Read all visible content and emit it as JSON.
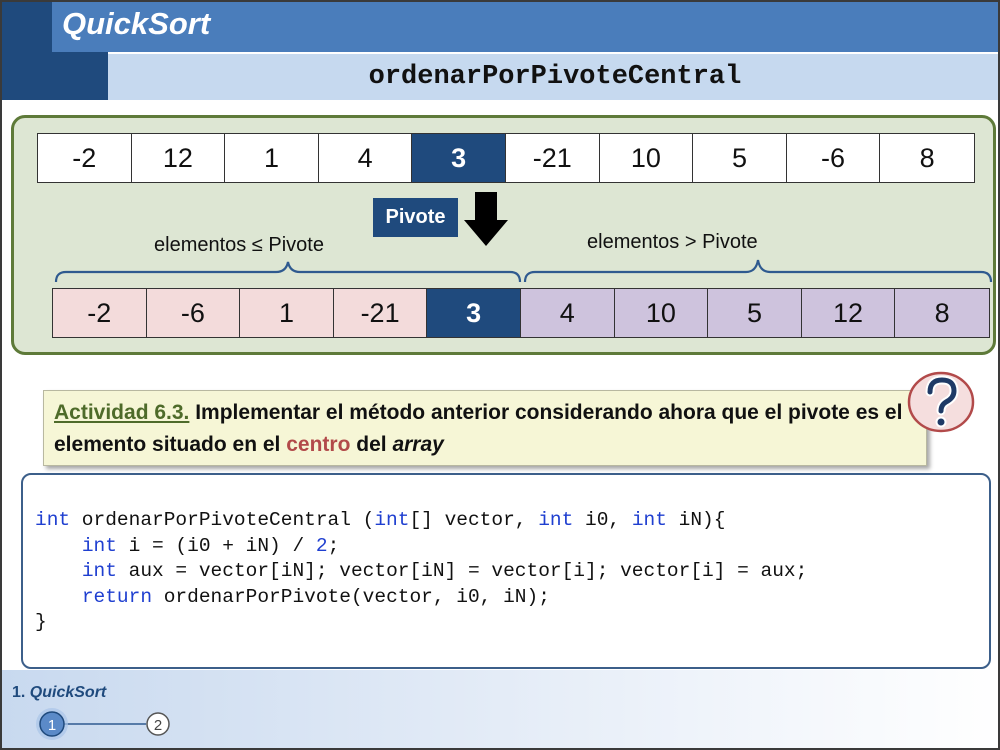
{
  "header": {
    "title": "QuickSort",
    "subtitle": "ordenarPorPivoteCentral"
  },
  "colors": {
    "header_dark": "#1f4a7d",
    "header_mid": "#4a7dbb",
    "header_light": "#c6d9ef",
    "pivot": "#1f4a7d",
    "left_partition": "#f3dbdb",
    "right_partition": "#cec3dd",
    "panel_bg": "#dde6d3",
    "panel_border": "#5e7a39"
  },
  "diagram": {
    "original_array": [
      "-2",
      "12",
      "1",
      "4",
      "3",
      "-21",
      "10",
      "5",
      "-6",
      "8"
    ],
    "pivot_index_original": 4,
    "pivot_label": "Pivote",
    "partitioned_array": [
      "-2",
      "-6",
      "1",
      "-21",
      "3",
      "4",
      "10",
      "5",
      "12",
      "8"
    ],
    "pivot_index_partitioned": 4,
    "label_left": "elementos ≤ Pivote",
    "label_right": "elementos > Pivote"
  },
  "activity": {
    "title": "Actividad 6.3.",
    "text_1": " Implementar el método anterior considerando ahora que el pivote es el elemento situado en el ",
    "highlight": "centro",
    "text_2": " del ",
    "italic": "array",
    "icon": "question-icon"
  },
  "code": {
    "line1_kw1": "int",
    "line1_a": " ordenarPorPivoteCentral (",
    "line1_kw2": "int",
    "line1_b": "[] vector, ",
    "line1_kw3": "int",
    "line1_c": " i0, ",
    "line1_kw4": "int",
    "line1_d": " iN){",
    "line2_kw": "int",
    "line2_a": " i = (i0 + iN) / ",
    "line2_num": "2",
    "line2_b": ";",
    "line3_kw": "int",
    "line3_a": " aux = vector[iN]; vector[iN] = vector[i]; vector[i] = aux;",
    "line4_kw": "return",
    "line4_a": " ordenarPorPivote(vector, i0, iN);",
    "line5": "}"
  },
  "footer": {
    "section_number": "1.",
    "section_name": "QuickSort",
    "nav_steps": [
      "1",
      "2"
    ],
    "current_step": 1
  }
}
